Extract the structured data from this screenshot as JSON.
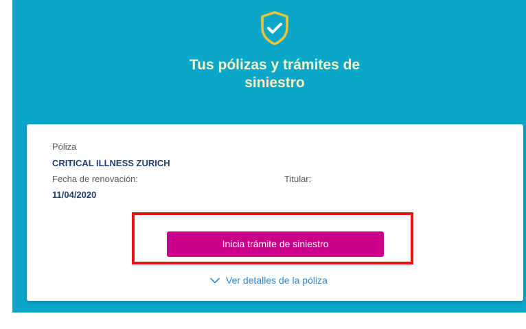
{
  "header": {
    "icon": "shield-check-icon",
    "title_line1": "Tus pólizas y trámites de",
    "title_line2": "siniestro"
  },
  "policy_card": {
    "policy_label": "Póliza",
    "policy_name": "CRITICAL ILLNESS ZURICH",
    "renewal_label": "Fecha de renovación:",
    "renewal_date": "11/04/2020",
    "holder_label": "Titular:",
    "claim_button_label": "Inicia trámite de siniestro",
    "details_link_label": "Ver detalles de la póliza",
    "details_icon": "chevron-down-icon"
  },
  "colors": {
    "band": "#0aa7c9",
    "title": "#f8efc2",
    "shield": "#f5c533",
    "value_text": "#1f3f74",
    "cta": "#c8008a",
    "link": "#2b8ad6",
    "highlight_frame": "#ee1111"
  }
}
